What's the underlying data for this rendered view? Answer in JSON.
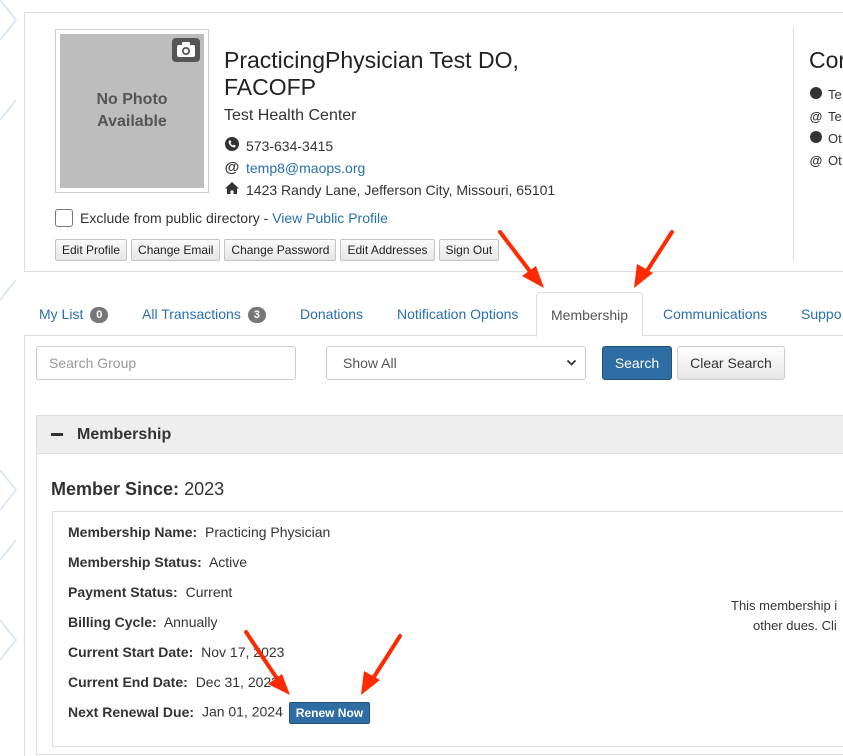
{
  "profile": {
    "photo_text": "No Photo Available",
    "name": "PracticingPhysician Test DO, FACOFP",
    "organization": "Test Health Center",
    "phone": "573-634-3415",
    "email": "temp8@maops.org",
    "address": "1423 Randy Lane, Jefferson City, Missouri, 65101",
    "exclude_label": "Exclude from public directory - ",
    "view_public_profile": "View Public Profile",
    "buttons": [
      "Edit Profile",
      "Change Email",
      "Change Password",
      "Edit Addresses",
      "Sign Out"
    ]
  },
  "contact_panel": {
    "title": "Cor",
    "lines": [
      {
        "icon": "phone-icon",
        "text": "Te"
      },
      {
        "icon": "at-icon",
        "text": "Te"
      },
      {
        "icon": "phone-icon",
        "text": "Ot"
      },
      {
        "icon": "at-icon",
        "text": "Ot"
      }
    ]
  },
  "tabs": [
    {
      "label": "My List",
      "badge": "0"
    },
    {
      "label": "All Transactions",
      "badge": "3"
    },
    {
      "label": "Donations"
    },
    {
      "label": "Notification Options"
    },
    {
      "label": "Membership",
      "active": true
    },
    {
      "label": "Communications"
    },
    {
      "label": "Suppo"
    }
  ],
  "search": {
    "placeholder": "Search Group",
    "select_value": "Show All",
    "search_button": "Search",
    "clear_button": "Clear Search"
  },
  "membership_panel": {
    "heading": "Membership",
    "member_since_label": "Member Since:",
    "member_since_value": "2023",
    "fields": [
      {
        "label": "Membership Name:",
        "value": "Practicing Physician"
      },
      {
        "label": "Membership Status:",
        "value": "Active"
      },
      {
        "label": "Payment Status:",
        "value": "Current"
      },
      {
        "label": "Billing Cycle:",
        "value": "Annually"
      },
      {
        "label": "Current Start Date:",
        "value": "Nov 17, 2023"
      },
      {
        "label": "Current End Date:",
        "value": "Dec 31, 2023"
      },
      {
        "label": "Next Renewal Due:",
        "value": "Jan 01, 2024"
      }
    ],
    "renew_button": "Renew Now",
    "note_line1": "This membership i",
    "note_line2": "other dues. Cli"
  },
  "colors": {
    "link": "#2a6fb0",
    "primary": "#2e6da4",
    "annotation_arrow": "#ff2a00"
  }
}
